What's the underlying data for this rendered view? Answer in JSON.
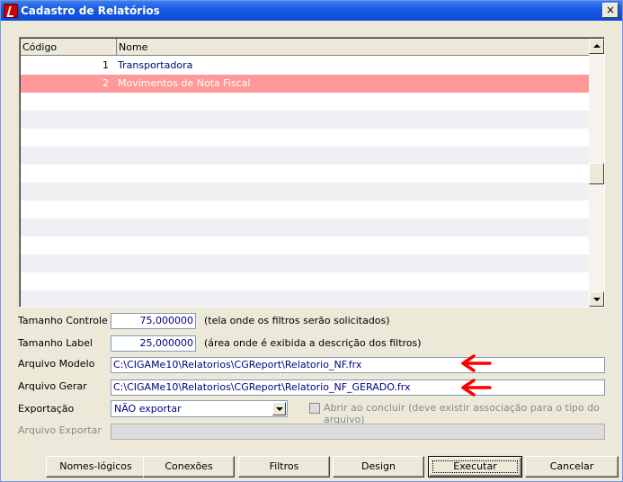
{
  "window": {
    "title": "Cadastro de Relatórios",
    "close_label": "×"
  },
  "grid": {
    "columns": [
      "Código",
      "Nome"
    ],
    "rows": [
      {
        "code": "1",
        "name": "Transportadora"
      },
      {
        "code": "2",
        "name": "Movimentos de Nota Fiscal"
      }
    ],
    "selected_index": 1,
    "selected_color": "#ff9999",
    "alt_row_color": "#eef0f4"
  },
  "form": {
    "tamanho_controle": {
      "label": "Tamanho Controle",
      "value": "75,000000",
      "note": "(tela onde os filtros serão solicitados)"
    },
    "tamanho_label": {
      "label": "Tamanho Label",
      "value": "25,000000",
      "note": "(área onde é exibida a descrição dos filtros)"
    },
    "arquivo_modelo": {
      "label": "Arquivo Modelo",
      "value": "C:\\CIGAMe10\\Relatorios\\CGReport\\Relatorio_NF.frx"
    },
    "arquivo_gerar": {
      "label": "Arquivo Gerar",
      "value": "C:\\CIGAMe10\\Relatorios\\CGReport\\Relatorio_NF_GERADO.frx"
    },
    "exportacao": {
      "label": "Exportação",
      "selected": "NÃO exportar"
    },
    "abrir_ao_concluir": {
      "label": "Abrir ao concluir (deve existir associação para o tipo do arquivo)",
      "checked": false
    },
    "arquivo_exportar": {
      "label": "Arquivo Exportar",
      "value": ""
    }
  },
  "annotation_color": "#ff0000",
  "buttons": {
    "nomes_logicos": "Nomes-lógicos",
    "conexoes": "Conexões",
    "filtros": "Filtros",
    "design": "Design",
    "executar": "Executar",
    "cancelar": "Cancelar"
  }
}
